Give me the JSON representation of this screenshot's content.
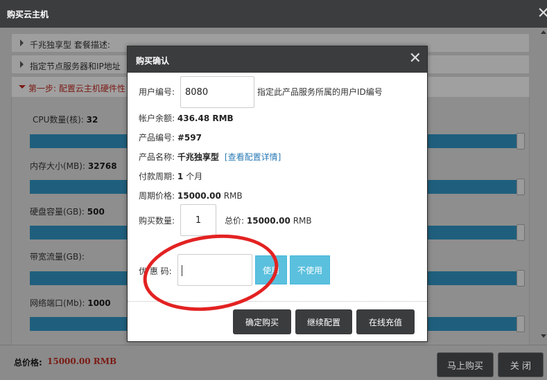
{
  "window": {
    "title": "购买云主机",
    "close_glyph": "✕"
  },
  "sections": {
    "item1": "千兆独享型 套餐描述:",
    "item2": "指定节点服务器和IP地址",
    "item3": "第一步: 配置云主机硬件性"
  },
  "specs": [
    {
      "label": "CPU数量(核):",
      "value": "32"
    },
    {
      "label": "内存大小(MB):",
      "value": "32768"
    },
    {
      "label": "硬盘容量(GB):",
      "value": "500"
    },
    {
      "label": "带宽流量(GB):",
      "value": ""
    },
    {
      "label": "网络端口(Mb):",
      "value": "1000"
    }
  ],
  "footer": {
    "total_label": "总价格:",
    "total_value": "15000.00 RMB",
    "buy_now": "马上购买",
    "close": "关 闭"
  },
  "modal": {
    "title": "购买确认",
    "close_glyph": "✕",
    "user_id_label": "用户编号:",
    "user_id_value": "8080",
    "user_id_hint": "指定此产品服务所属的用户ID编号",
    "balance_label": "帐户余额:",
    "balance_value": "436.48 RMB",
    "product_no_label": "产品编号:",
    "product_no_value": "#597",
    "product_name_label": "产品名称:",
    "product_name_value": "千兆独享型",
    "product_detail_link": "[查看配置详情]",
    "period_label": "付款周期:",
    "period_value": "1",
    "period_unit": "个月",
    "period_price_label": "周期价格:",
    "period_price_value": "15000.00",
    "period_price_unit": "RMB",
    "qty_label": "购买数量:",
    "qty_value": "1",
    "total_label": "总价:",
    "total_value": "15000.00",
    "total_unit": "RMB",
    "coupon_label": "优 惠 码:",
    "use_btn": "使用",
    "no_use_btn": "不使用",
    "confirm_btn": "确定购买",
    "continue_btn": "继续配置",
    "recharge_btn": "在线充值"
  }
}
